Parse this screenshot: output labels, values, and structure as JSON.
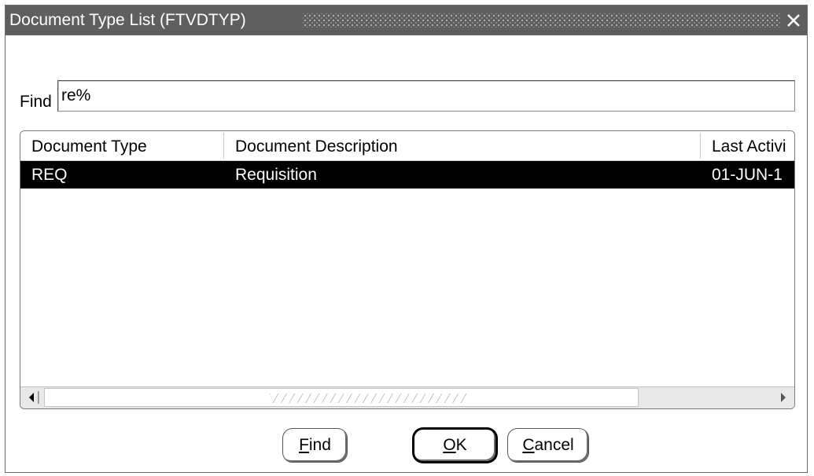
{
  "window": {
    "title": "Document Type List (FTVDTYP)",
    "close_icon": "close-icon"
  },
  "search": {
    "label": "Find",
    "value": "re%"
  },
  "list": {
    "columns": [
      "Document Type",
      "Document Description",
      "Last Activi"
    ],
    "rows": [
      {
        "document_type": "REQ",
        "document_description": "Requisition",
        "last_activity": "01-JUN-1"
      }
    ],
    "selected_row": 0,
    "icons": {
      "scroll_left": "chevron-left-icon",
      "scroll_right": "chevron-right-icon"
    }
  },
  "buttons": {
    "find": {
      "mnemonic": "F",
      "rest": "ind"
    },
    "ok": {
      "mnemonic": "O",
      "rest": "K"
    },
    "cancel": {
      "mnemonic": "C",
      "rest": "ancel"
    }
  },
  "colors": {
    "titlebar": "#5f5f5f",
    "selection": "#000000",
    "selection_text": "#ffffff"
  }
}
